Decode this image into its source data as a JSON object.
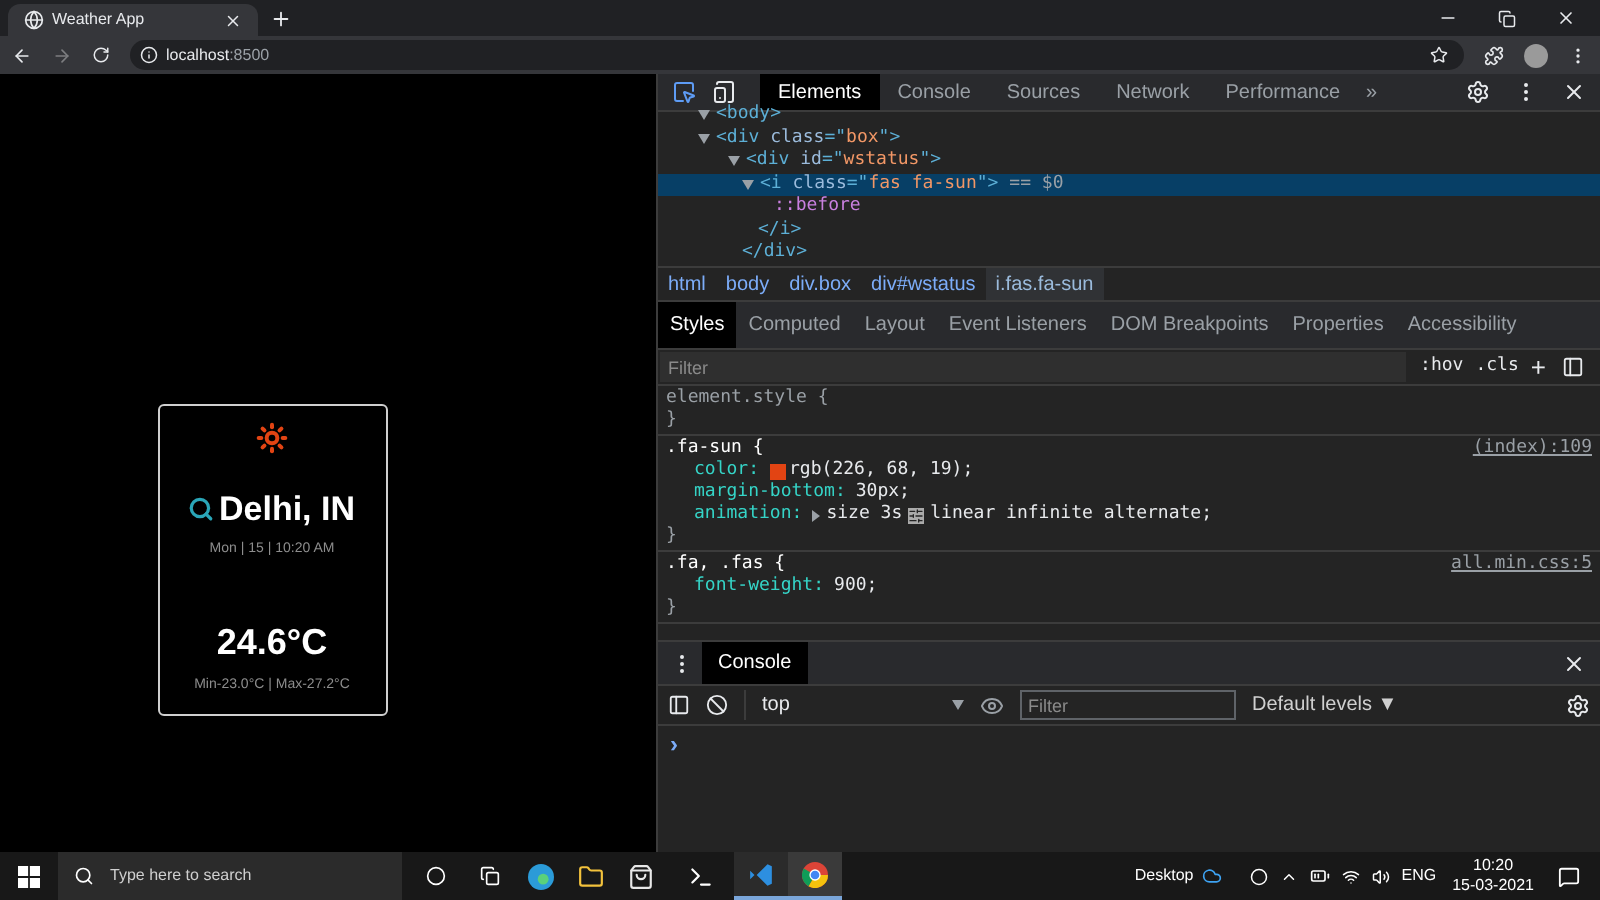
{
  "browser": {
    "tab_title": "Weather App",
    "url_host": "localhost",
    "url_port": ":8500"
  },
  "weather": {
    "city": "Delhi, IN",
    "date": "Mon | 15 | 10:20 AM",
    "temperature": "24.6°C",
    "min_max": "Min-23.0°C | Max-27.2°C"
  },
  "devtools": {
    "tabs": [
      {
        "label": "Elements",
        "selected": true
      },
      {
        "label": "Console",
        "selected": false
      },
      {
        "label": "Sources",
        "selected": false
      },
      {
        "label": "Network",
        "selected": false
      },
      {
        "label": "Performance",
        "selected": false
      }
    ],
    "more": "»",
    "dom_lines": [
      {
        "kind": "open",
        "selected": false,
        "tokens": [
          {
            "text": "<body>",
            "kind": "tag"
          }
        ]
      },
      {
        "kind": "open",
        "selected": false,
        "tokens": [
          {
            "text": "<div ",
            "kind": "tag"
          },
          {
            "text": "class",
            "kind": "attr"
          },
          {
            "text": "=\"",
            "kind": "tag"
          },
          {
            "text": "box",
            "kind": "value"
          },
          {
            "text": "\">",
            "kind": "tag"
          }
        ]
      },
      {
        "kind": "open",
        "selected": false,
        "tokens": [
          {
            "text": "<div ",
            "kind": "tag"
          },
          {
            "text": "id",
            "kind": "attr"
          },
          {
            "text": "=\"",
            "kind": "tag"
          },
          {
            "text": "wstatus",
            "kind": "value"
          },
          {
            "text": "\">",
            "kind": "tag"
          }
        ]
      },
      {
        "kind": "open",
        "selected": true,
        "tokens": [
          {
            "text": "<i ",
            "kind": "tag"
          },
          {
            "text": "class",
            "kind": "attr"
          },
          {
            "text": "=\"",
            "kind": "tag"
          },
          {
            "text": "fas fa-sun",
            "kind": "value"
          },
          {
            "text": "\">",
            "kind": "tag"
          },
          {
            "text": " == $0",
            "kind": "note"
          }
        ]
      },
      {
        "kind": "pseudo",
        "selected": false,
        "tokens": [
          {
            "text": "::before",
            "kind": "pseudo"
          }
        ]
      },
      {
        "kind": "close",
        "selected": false,
        "tokens": [
          {
            "text": "</i>",
            "kind": "tag"
          }
        ]
      },
      {
        "kind": "close",
        "selected": false,
        "tokens": [
          {
            "text": "</div>",
            "kind": "tag"
          }
        ]
      }
    ],
    "breadcrumbs": [
      {
        "label": "html",
        "selected": false
      },
      {
        "label": "body",
        "selected": false
      },
      {
        "label": "div.box",
        "selected": false
      },
      {
        "label": "div#wstatus",
        "selected": false
      },
      {
        "label": "i.fas.fa-sun",
        "selected": true
      }
    ],
    "style_tabs": [
      {
        "label": "Styles",
        "selected": true
      },
      {
        "label": "Computed",
        "selected": false
      },
      {
        "label": "Layout",
        "selected": false
      },
      {
        "label": "Event Listeners",
        "selected": false
      },
      {
        "label": "DOM Breakpoints",
        "selected": false
      },
      {
        "label": "Properties",
        "selected": false
      },
      {
        "label": "Accessibility",
        "selected": false
      }
    ],
    "filter": {
      "placeholder": "Filter",
      "hov": ":hov",
      "cls": ".cls",
      "add": "+"
    },
    "rules": [
      {
        "selector": "element.style {",
        "close": "}"
      },
      {
        "selector": ".fa-sun {",
        "source": "(index):109",
        "close": "}",
        "props": [
          {
            "kind": "color",
            "name": "color:",
            "value": "rgb(226, 68, 19);",
            "color": "#e24413"
          },
          {
            "kind": "plain",
            "name": "margin-bottom:",
            "value": "30px;"
          },
          {
            "kind": "animation",
            "name": "animation:",
            "value": "size 3s",
            "value_2": "linear infinite alternate;"
          }
        ]
      },
      {
        "selector": ".fa, .fas {",
        "source": "all.min.css:5",
        "close": "}",
        "props": [
          {
            "kind": "plain",
            "name": "font-weight:",
            "value": "900;"
          }
        ]
      }
    ],
    "drawer": {
      "tab": {
        "label": "Console",
        "selected": true
      },
      "context": "top",
      "filter_placeholder": "Filter",
      "levels": "Default levels ▼",
      "prompt": "›"
    }
  },
  "taskbar": {
    "search_placeholder": "Type here to search",
    "desktop": "Desktop",
    "language": "ENG",
    "time": "10:20",
    "date": "15-03-2021"
  }
}
